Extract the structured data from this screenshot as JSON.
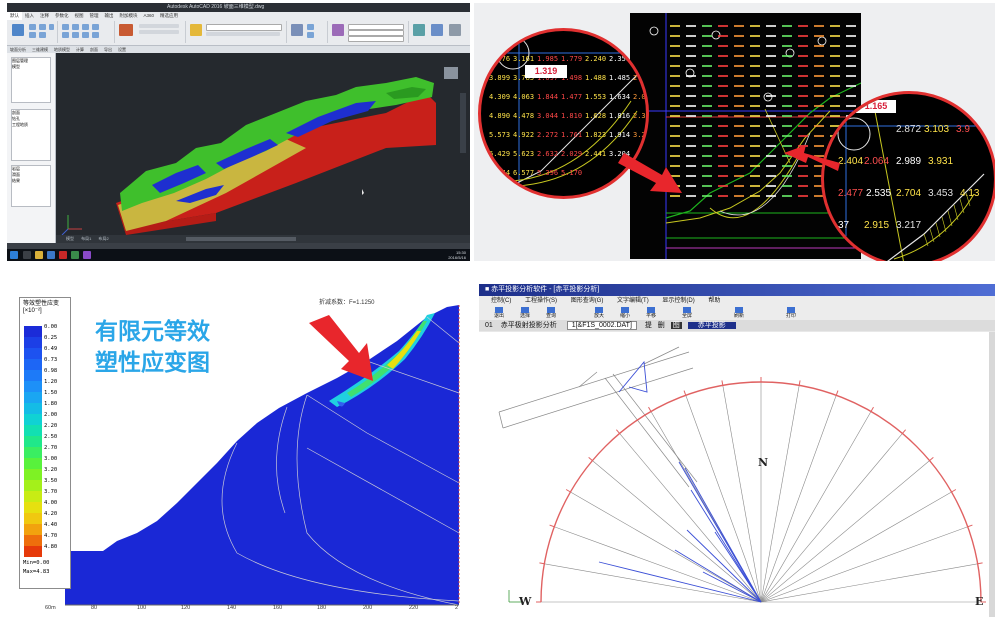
{
  "cad": {
    "title": "Autodesk AutoCAD 2016  坡面三维模型.dwg",
    "ribbon_tabs": [
      "默认",
      "插入",
      "注释",
      "参数化",
      "视图",
      "管理",
      "输出",
      "附加模块",
      "A360",
      "精选应用"
    ],
    "ribbon_groups": [
      "绘图",
      "修改",
      "注释",
      "图层",
      "块",
      "特性",
      "组",
      "实用工具"
    ],
    "toolbar_items": [
      "坡面分析",
      "三维建模",
      "地质模型",
      "计算",
      "剖面",
      "导出",
      "设置"
    ],
    "side_items": [
      "图层管理",
      "模型",
      "剖面",
      "钻孔",
      "工程地质",
      "岩层",
      "滑面",
      "结果"
    ],
    "layout_tabs": [
      "模型",
      "布局1",
      "布局2"
    ],
    "clock_time": "15:30",
    "clock_date": "2016/5/16"
  },
  "stability": {
    "left_values": [
      [
        "3.476",
        "3.161",
        "1.985",
        "1.779",
        "2.240",
        "2.351",
        "2.4"
      ],
      [
        "3.899",
        "3.785",
        "1.697",
        "1.498",
        "1.488",
        "1.485",
        "2.676"
      ],
      [
        "4.309",
        "4.063",
        "1.844",
        "1.477",
        "1.553",
        "1.634",
        "2.025"
      ],
      [
        "4.890",
        "4.478",
        "3.044",
        "1.810",
        "1.628",
        "1.816",
        "2.384"
      ],
      [
        "5.573",
        "4.922",
        "2.272",
        "1.761",
        "1.823",
        "1.914",
        "3.201"
      ],
      [
        "6.429",
        "5.623",
        "2.632",
        "2.029",
        "2.441",
        "3.204",
        ""
      ],
      [
        "7.244",
        "6.577",
        "5.396",
        "5.170",
        "",
        "",
        ""
      ]
    ],
    "left_min_fs": "1.319",
    "right_values": [
      [
        "2.872",
        "3.103",
        "3.9"
      ],
      [
        "2.404",
        "2.064",
        "2.989",
        "3.931"
      ],
      [
        "2.477",
        "2.535",
        "2.704",
        "3.453",
        "4.13"
      ],
      [
        "37",
        "2.915",
        "3.217",
        ""
      ]
    ],
    "right_min_fs": "1.165",
    "arrow_color": "#e8262c",
    "circle_border_color": "#e03030"
  },
  "fem": {
    "heading_line1": "有限元等效",
    "heading_line2": "塑性应变图",
    "legend_title_line1": "等效塑性应变",
    "legend_title_line2": "[×10⁻²]",
    "legend_values": [
      "0.00",
      "0.25",
      "0.49",
      "0.73",
      "0.98",
      "1.20",
      "1.50",
      "1.80",
      "2.00",
      "2.20",
      "2.50",
      "2.70",
      "3.00",
      "3.20",
      "3.50",
      "3.70",
      "4.00",
      "4.20",
      "4.40",
      "4.70",
      "4.80"
    ],
    "legend_colors": [
      "#1b2bd8",
      "#1c3fe6",
      "#1d52f0",
      "#1d66f5",
      "#1d7af8",
      "#1d90f8",
      "#1aa6f2",
      "#14bce6",
      "#10d2d4",
      "#12e0b2",
      "#20e88a",
      "#3aee62",
      "#58f23c",
      "#7ef224",
      "#a4f01a",
      "#c8ec14",
      "#e6e010",
      "#f0c810",
      "#f2a20e",
      "#ee6e0c",
      "#e63a0a"
    ],
    "legend_min": "Min=0.00",
    "legend_max": "Max=4.83",
    "factor": "折减系数：F=1.1250",
    "x_ticks": [
      "60m",
      "80",
      "100",
      "120",
      "140",
      "160",
      "180",
      "200",
      "220",
      "2"
    ],
    "arrow_color": "#e8262c",
    "body_color": "#1a28d6"
  },
  "stereo": {
    "title": "■  赤平投影分析软件 - [赤平投影分析]",
    "menu": [
      "控制(C)",
      "工程操作(S)",
      "图形查询(G)",
      "文字编辑(T)",
      "显示控制(D)",
      "帮助"
    ],
    "tools": [
      "退出",
      "选择",
      "查询",
      "放大",
      "缩小",
      "平移",
      "全屏",
      "刷新",
      "打印"
    ],
    "combo_prefix": "01",
    "combo_label": "赤平极射投影分析",
    "combo_file": "1[&F1S_0002.DAT]",
    "combo_tabs": [
      "提",
      "删",
      "图",
      "赤平投影"
    ],
    "north": "N",
    "west": "W",
    "east": "E",
    "arc_color": "#e06262",
    "line_color": "#3b4fd6"
  }
}
